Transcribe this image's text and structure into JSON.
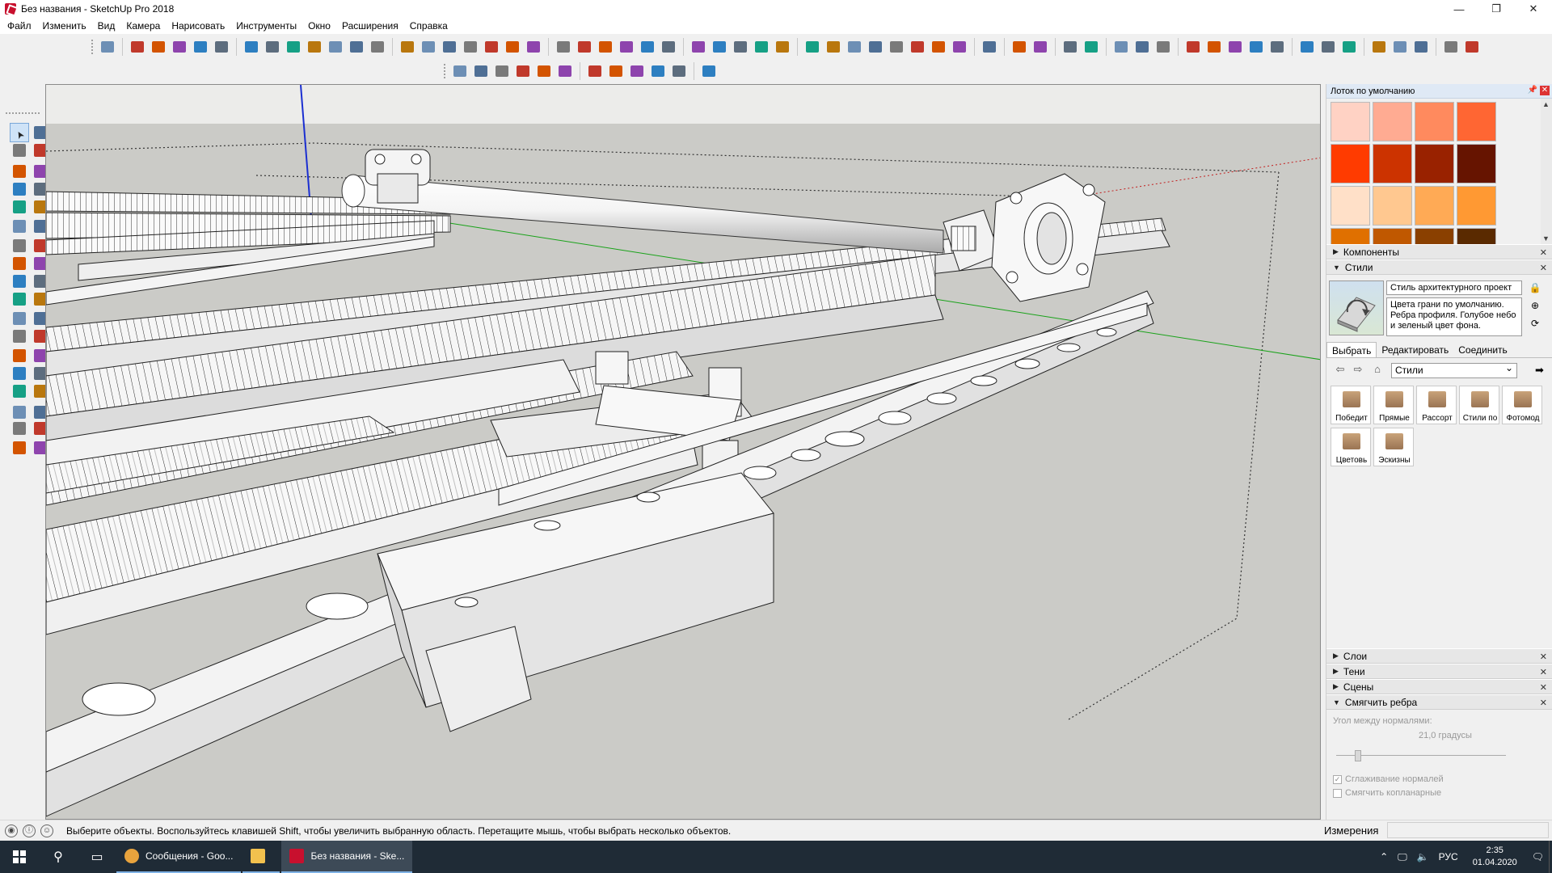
{
  "window": {
    "title": "Без названия - SketchUp Pro 2018",
    "controls": [
      "—",
      "❐",
      "✕"
    ]
  },
  "menu": [
    "Файл",
    "Изменить",
    "Вид",
    "Камера",
    "Нарисовать",
    "Инструменты",
    "Окно",
    "Расширения",
    "Справка"
  ],
  "tray": {
    "title": "Лоток по умолчанию",
    "swatches": [
      "#ffd2c4",
      "#ffab92",
      "#ff8a5e",
      "#ff6633",
      "#ff3b00",
      "#cc3300",
      "#992200",
      "#661400",
      "#ffe0c8",
      "#ffc890",
      "#ffaa55",
      "#ff9933",
      "#e07000",
      "#c05800",
      "#8a4000",
      "#5a2a00"
    ],
    "sections": {
      "components": "Компоненты",
      "styles": "Стили",
      "layers": "Слои",
      "shadows": "Тени",
      "scenes": "Сцены",
      "soften": "Смягчить ребра"
    },
    "style": {
      "name": "Стиль архитектурного проект",
      "description": "Цвета грани по умолчанию. Ребра профиля. Голубое небо и зеленый цвет фона.",
      "tabs": [
        "Выбрать",
        "Редактировать",
        "Соединить"
      ],
      "collection": "Стили",
      "library": [
        "Победит",
        "Прямые",
        "Рассорт",
        "Стили по",
        "Фотомод",
        "Цветовь",
        "Эскизны"
      ]
    },
    "softening": {
      "angle_label": "Угол между нормалями:",
      "angle_value": "21,0  градусы",
      "angle_degrees": 21.0,
      "smooth_normals": "Сглаживание нормалей",
      "smooth_normals_checked": true,
      "soften_coplanar": "Смягчить копланарные",
      "soften_coplanar_checked": false
    }
  },
  "status": {
    "hint": "Выберите объекты. Воспользуйтесь клавишей Shift, чтобы увеличить выбранную область. Перетащите мышь, чтобы выбрать несколько объектов.",
    "measurements_label": "Измерения",
    "measurements_value": ""
  },
  "taskbar": {
    "apps": [
      {
        "label": "Сообщения - Goo...",
        "color": "#e8a33d"
      },
      {
        "label": "",
        "color": "#f2c14e"
      },
      {
        "label": "Без названия - Ske...",
        "color": "#c8102e"
      }
    ],
    "lang": "РУС",
    "time": "2:35",
    "date": "01.04.2020"
  },
  "colors": {
    "sky": "#e9e9e6",
    "ground": "#c9c9c5",
    "axis_blue": "#1b2fd1",
    "axis_green": "#19a219",
    "axis_red": "#c21d1d"
  }
}
